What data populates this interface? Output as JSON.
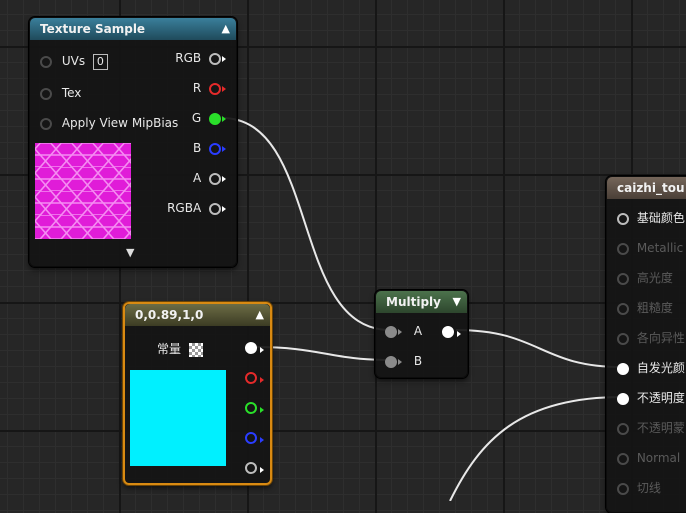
{
  "texture_node": {
    "title": "Texture Sample",
    "inputs": [
      {
        "label": "UVs",
        "value": "0"
      },
      {
        "label": "Tex"
      },
      {
        "label": "Apply View MipBias"
      }
    ],
    "outputs": [
      "RGB",
      "R",
      "G",
      "B",
      "A",
      "RGBA"
    ],
    "colors": {
      "header": "#2f6d86",
      "preview": "#e01cd8",
      "hex_line": "#f58cf2"
    }
  },
  "const_node": {
    "title": "0,0.89,1,0",
    "label": "常量",
    "preview_color": "#00f0ff",
    "colors": {
      "header": "#5a5a36",
      "border": "#d98a12"
    }
  },
  "multiply_node": {
    "title": "Multiply",
    "inputs": [
      "A",
      "B"
    ],
    "colors": {
      "header": "#3c5a3c"
    }
  },
  "material_node": {
    "title": "caizhi_tou",
    "pins": [
      {
        "label": "基础颜色",
        "active": true
      },
      {
        "label": "Metallic",
        "active": false
      },
      {
        "label": "高光度",
        "active": false
      },
      {
        "label": "粗糙度",
        "active": false
      },
      {
        "label": "各向异性",
        "active": false
      },
      {
        "label": "自发光颜",
        "active": true
      },
      {
        "label": "不透明度",
        "active": true
      },
      {
        "label": "不透明蒙",
        "active": false
      },
      {
        "label": "Normal",
        "active": false
      },
      {
        "label": "切线",
        "active": false
      }
    ],
    "colors": {
      "header": "#5e5148"
    }
  },
  "pin_colors": {
    "R": "#e52a2a",
    "G": "#2adf2a",
    "B": "#2a3dff",
    "A": "#cfcfcf"
  }
}
